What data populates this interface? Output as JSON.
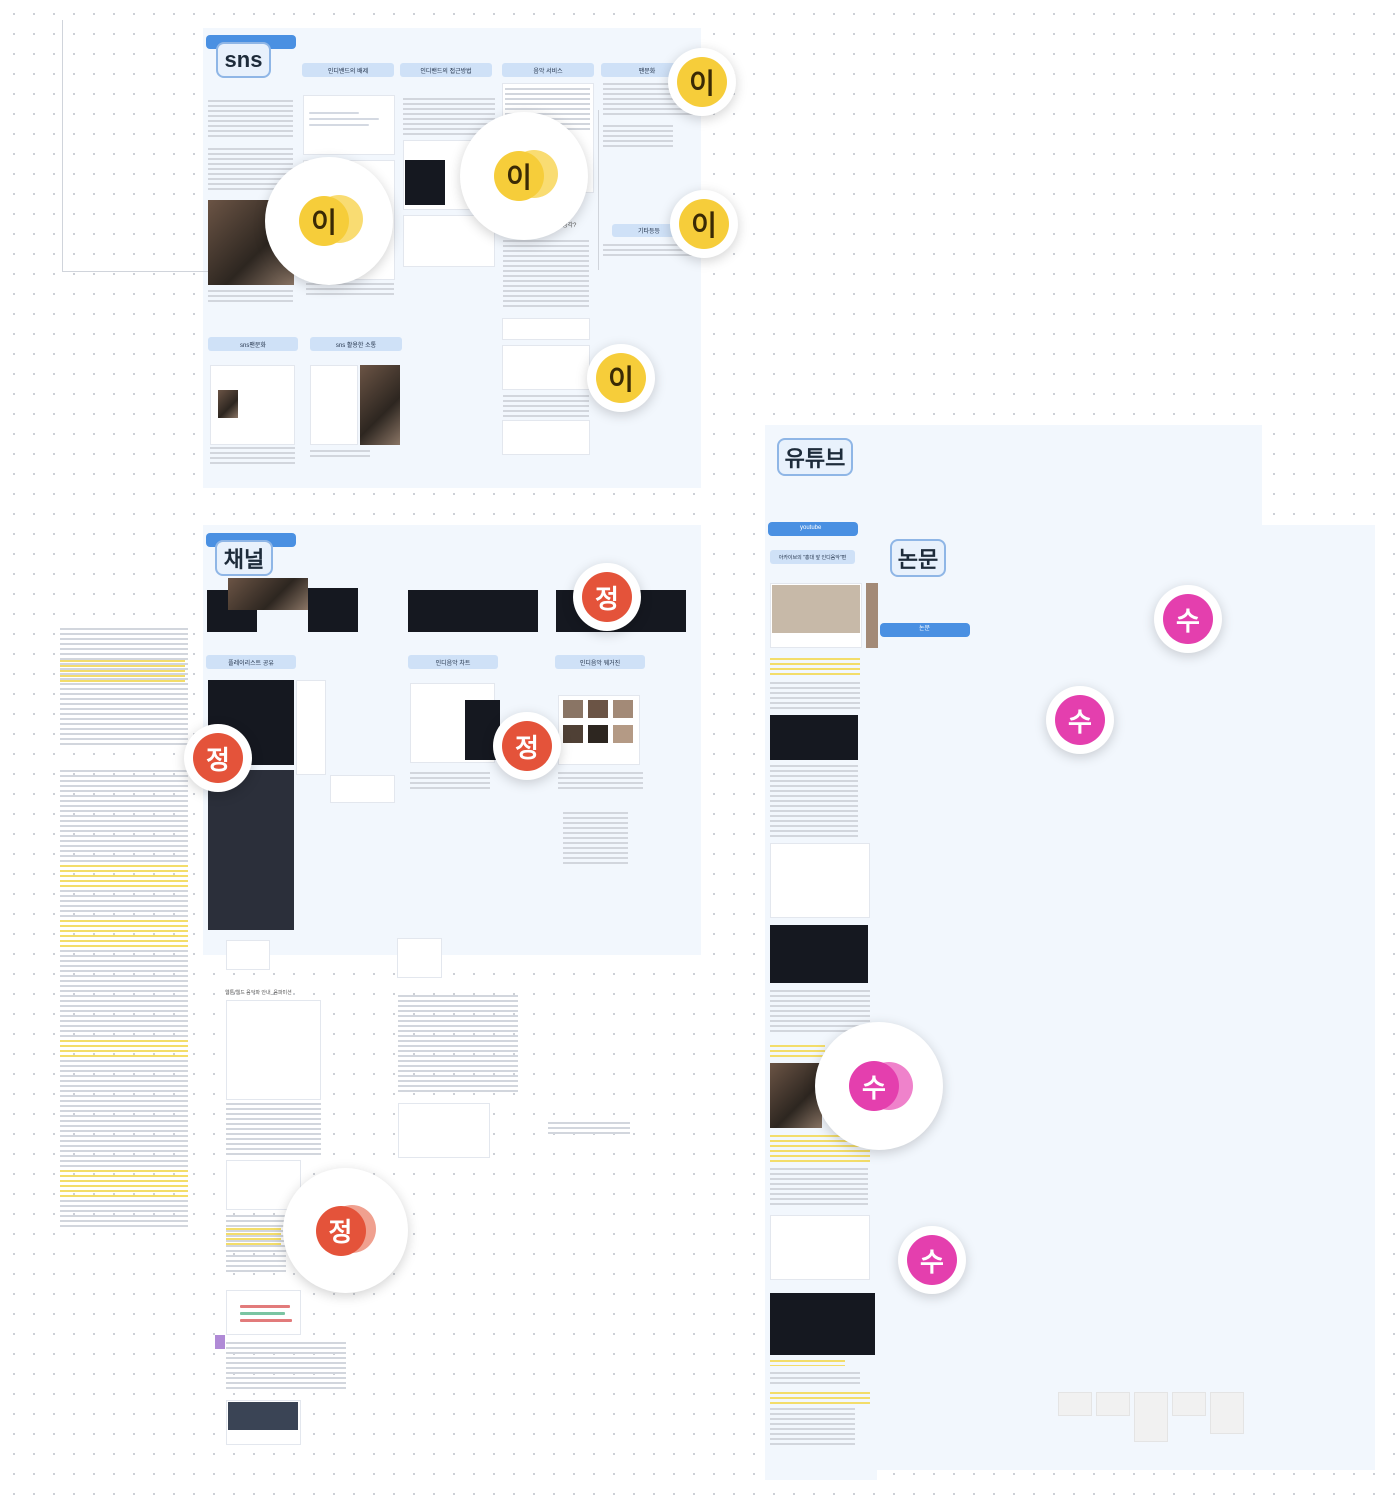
{
  "sections": {
    "sns": {
      "tag": "sns",
      "columns": [
        "인디밴드의 배제",
        "인디밴드의 접근방법",
        "음악 서비스",
        "팬문화"
      ],
      "sub_headers": [
        "sns팬문화",
        "sns 활용한 소통"
      ],
      "captions": [
        "기타등등",
        "생각?"
      ]
    },
    "channel": {
      "tag": "채널",
      "columns": [
        "플레이리스트 공유",
        "인디음악 차트",
        "인디음악 웨거진"
      ],
      "caption_bottom": "웹툰/웹드 음악파 안내_음파미션"
    },
    "youtube": {
      "tag": "유튜브",
      "bar_label": "youtube",
      "sub_label": "아카이브의 \"홍대 앞 인디음악\"편"
    },
    "paper": {
      "tag": "논문",
      "bar_label": "논문"
    }
  },
  "stamps": {
    "yellow": "이",
    "red": "정",
    "pink": "수"
  },
  "colors": {
    "section_bg": "#f2f7fd",
    "accent_blue": "#4a90e2",
    "stamp_yellow": "#f6cd3a",
    "stamp_red": "#e4533a",
    "stamp_pink": "#e43fae"
  }
}
